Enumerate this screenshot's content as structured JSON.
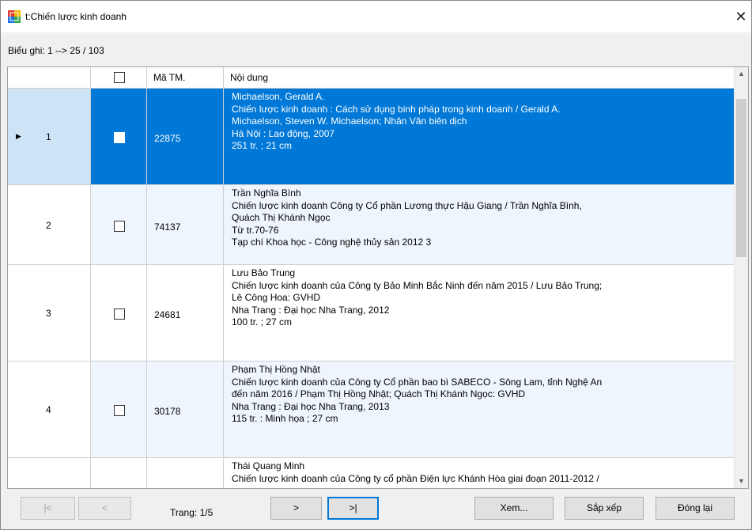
{
  "window": {
    "title": "t:Chiến lược kinh doanh",
    "close_glyph": "✕"
  },
  "record_info": "Biểu ghi: 1 --> 25 / 103",
  "grid": {
    "columns": [
      "",
      "",
      "Mã TM.",
      "Nội dung"
    ],
    "rows": [
      {
        "num": "1",
        "code": "22875",
        "selected": true,
        "lines": [
          "Michaelson, Gerald A.",
          "Chiến lược kinh doanh :  Cách sử dụng binh pháp trong kinh doanh /  Gerald A.",
          "Michaelson, Steven W. Michaelson; Nhân Văn biên dịch",
          "Hà Nội :  Lao động,  2007",
          "251 tr. ;  21 cm"
        ]
      },
      {
        "num": "2",
        "code": "74137",
        "selected": false,
        "lines": [
          "Trần Nghĩa Bình",
          "Chiến lược kinh doanh Công ty Cổ phần Lương thực Hậu Giang /  Trần Nghĩa Bình,",
          "Quách Thị Khánh Ngọc",
          "Từ tr.70-76",
          "Tạp chí Khoa học - Công nghệ thủy sản  2012 3"
        ]
      },
      {
        "num": "3",
        "code": "24681",
        "selected": false,
        "lines": [
          "Lưu Bảo Trung",
          "Chiến lược kinh doanh của Công ty Bảo Minh Bắc Ninh đến năm 2015 /  Lưu Bảo Trung;",
          "Lê Công Hoa: GVHD",
          "Nha Trang :  Đại học Nha Trang,  2012",
          "100 tr. ;  27 cm"
        ]
      },
      {
        "num": "4",
        "code": "30178",
        "selected": false,
        "lines": [
          "Phạm Thị Hồng Nhật",
          "Chiến lược kinh doanh của Công ty Cổ phần bao bì SABECO - Sông Lam, tỉnh Nghệ An",
          "đến năm 2016 /  Phạm Thị Hồng Nhật; Quách Thị Khánh Ngọc: GVHD",
          "Nha Trang :  Đại học Nha Trang,  2013",
          "115 tr. :  Minh họa ;  27 cm"
        ]
      },
      {
        "num": "",
        "code": "",
        "selected": false,
        "lines": [
          "Thái Quang Minh",
          "Chiến lược kinh doanh của Công ty cổ phần Điện lực Khánh Hòa giai đoạn 2011-2012 /"
        ]
      }
    ]
  },
  "footer": {
    "first_label": "|<",
    "prev_label": "<",
    "page_label": "Trang: 1/5",
    "next_label": ">",
    "last_label": ">|",
    "view_label": "Xem...",
    "sort_label": "Sắp xếp",
    "close_label": "Đóng lại"
  }
}
